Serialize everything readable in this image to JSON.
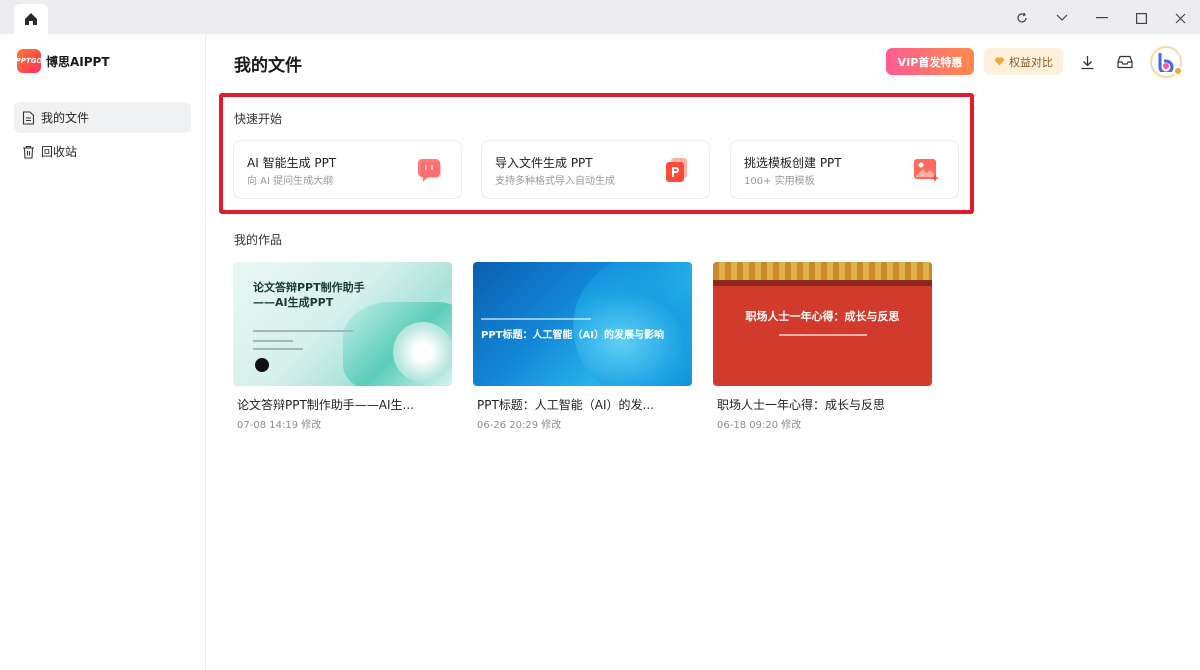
{
  "app": {
    "name": "博思AIPPT",
    "logo_text": "PPTGO"
  },
  "sidebar": {
    "items": [
      {
        "label": "我的文件",
        "icon": "document-icon",
        "active": true
      },
      {
        "label": "回收站",
        "icon": "trash-icon",
        "active": false
      }
    ]
  },
  "header": {
    "title": "我的文件",
    "vip_label": "VIP首发特惠",
    "compare_label": "权益对比"
  },
  "quick_start": {
    "label": "快速开始",
    "cards": [
      {
        "title": "AI 智能生成 PPT",
        "subtitle": "向 AI 提问生成大纲",
        "icon": "ai-chat-icon"
      },
      {
        "title": "导入文件生成 PPT",
        "subtitle": "支持多种格式导入自动生成",
        "icon": "ppt-file-icon"
      },
      {
        "title": "挑选模板创建 PPT",
        "subtitle": "100+ 实用模板",
        "icon": "template-image-icon"
      }
    ]
  },
  "works": {
    "label": "我的作品",
    "items": [
      {
        "title": "论文答辩PPT制作助手——AI生...",
        "meta": "07-08 14:19 修改",
        "thumb_title": "论文答辩PPT制作助手——AI生成PPT"
      },
      {
        "title": "PPT标题：人工智能（AI）的发...",
        "meta": "06-26 20:29 修改",
        "thumb_title": "PPT标题：人工智能（AI）的发展与影响"
      },
      {
        "title": "职场人士一年心得：成长与反思",
        "meta": "06-18 09:20 修改",
        "thumb_title": "职场人士一年心得：成长与反思"
      }
    ]
  },
  "colors": {
    "highlight_border": "#e21a2c",
    "brand": "#ff5a3c"
  }
}
